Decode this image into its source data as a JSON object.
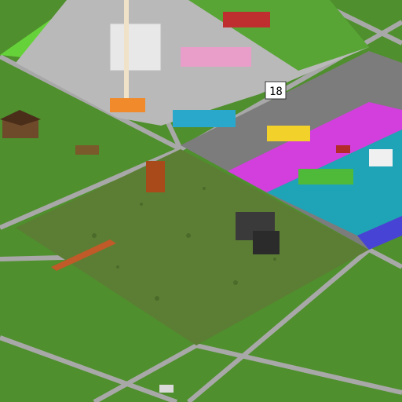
{
  "scene": {
    "view": "isometric-voxel-world-overview",
    "palette": {
      "grass_light": "#5aa33a",
      "grass_dark": "#3f7f25",
      "road": "#9a9a9a",
      "road_edge": "#bdbdbd",
      "plaza_floor": "#c9c9c9",
      "dirt_plot": "#6d8a3a",
      "pool_magenta": "#d63be0",
      "pool_cyan": "#1fa6b8",
      "pool_blue": "#4a47d6",
      "wall_gray": "#7a7a7a"
    },
    "plots": [
      {
        "name": "lime-build-plot",
        "color": "#6fd63a"
      },
      {
        "name": "gray-city-plot",
        "color": "#9a9a9a"
      },
      {
        "name": "terrain-plot",
        "color": "#6d8a3a"
      },
      {
        "name": "pool-plot",
        "color": "#1fa6b8"
      }
    ],
    "scoreboard_text": "18"
  }
}
